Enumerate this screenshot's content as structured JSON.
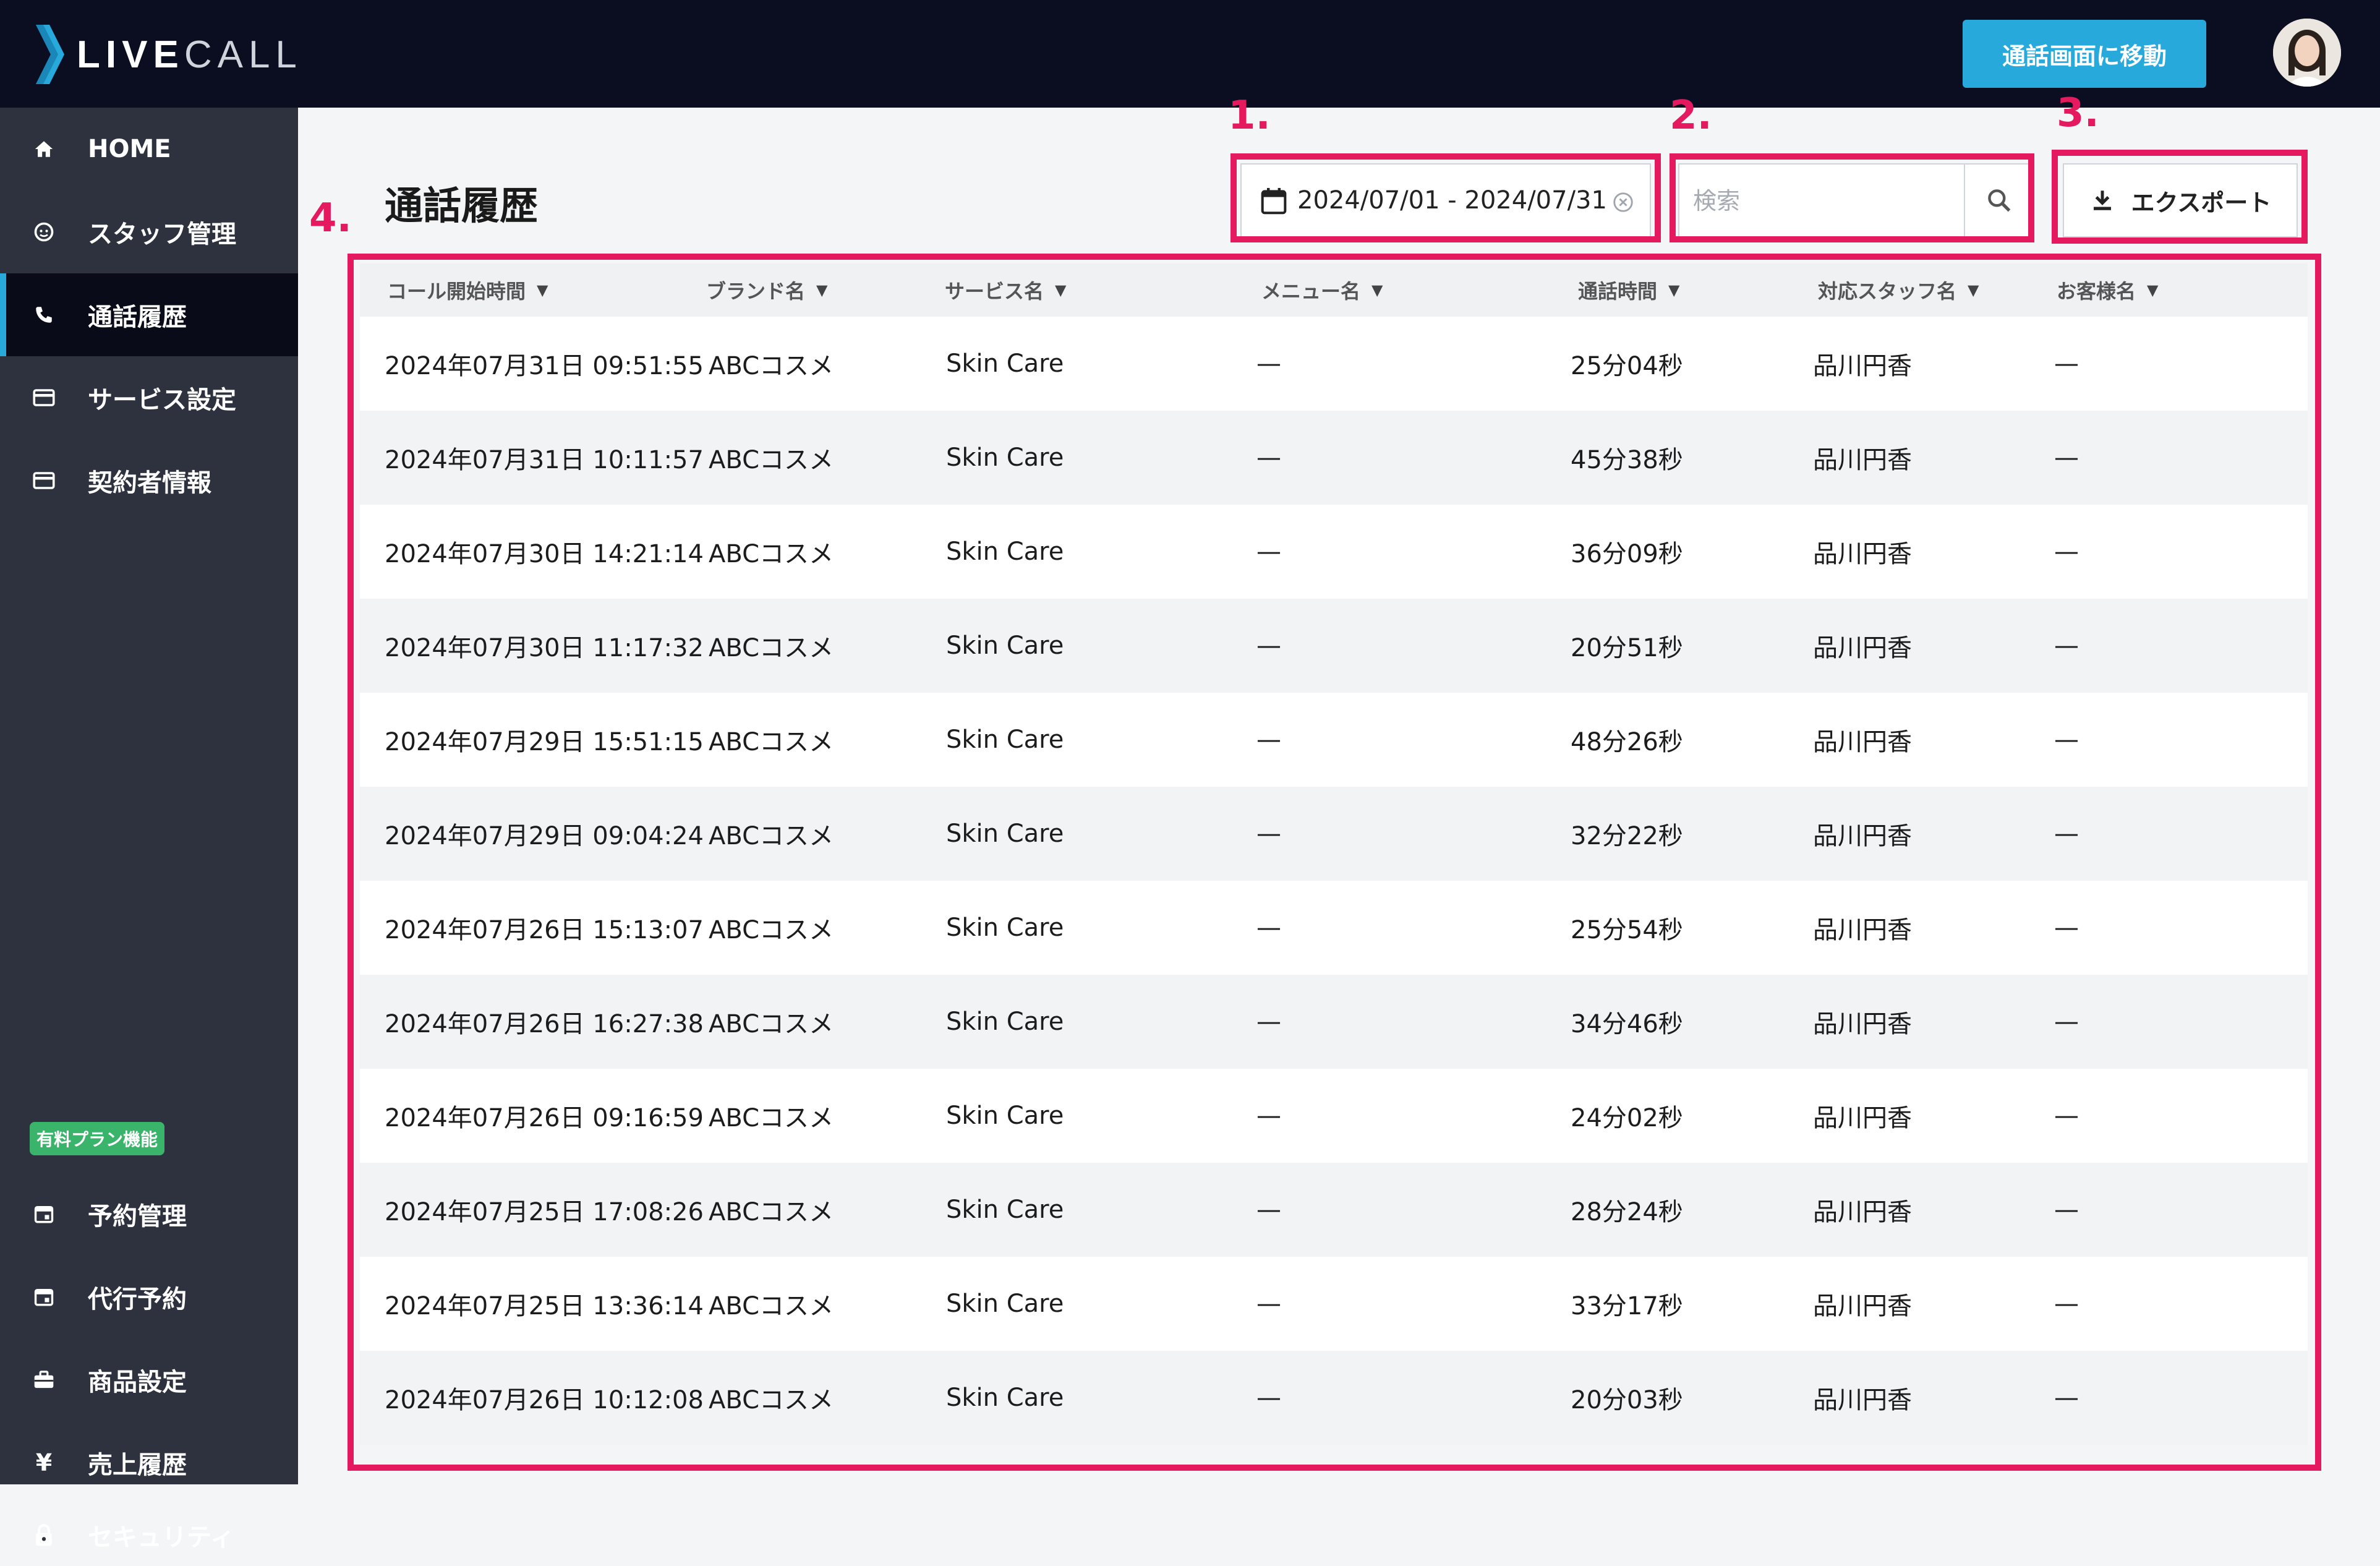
{
  "app": {
    "logo_bold": "LIVE",
    "logo_light": "CALL"
  },
  "header": {
    "call_screen_button": "通話画面に移動"
  },
  "sidebar": {
    "items": [
      {
        "label": "HOME",
        "icon": "home-icon"
      },
      {
        "label": "スタッフ管理",
        "icon": "staff-icon"
      },
      {
        "label": "通話履歴",
        "icon": "phone-icon",
        "active": true
      },
      {
        "label": "サービス設定",
        "icon": "card-icon"
      },
      {
        "label": "契約者情報",
        "icon": "card-icon"
      }
    ],
    "paid_badge": "有料プラン機能",
    "paid_items": [
      {
        "label": "予約管理",
        "icon": "calendar-icon"
      },
      {
        "label": "代行予約",
        "icon": "calendar-icon"
      },
      {
        "label": "商品設定",
        "icon": "briefcase-icon"
      },
      {
        "label": "売上履歴",
        "icon": "yen-icon"
      },
      {
        "label": "セキュリティ",
        "icon": "lock-icon"
      }
    ]
  },
  "main": {
    "title": "通話履歴",
    "date_range": "2024/07/01 - 2024/07/31",
    "search_placeholder": "検索",
    "export_label": "エクスポート",
    "annotations": [
      "1.",
      "2.",
      "3.",
      "4."
    ]
  },
  "table": {
    "headers": [
      "コール開始時間",
      "ブランド名",
      "サービス名",
      "メニュー名",
      "通話時間",
      "対応スタッフ名",
      "お客様名"
    ],
    "rows": [
      [
        "2024年07月31日 09:51:55",
        "ABCコスメ",
        "Skin Care",
        "—",
        "25分04秒",
        "品川円香",
        "—"
      ],
      [
        "2024年07月31日 10:11:57",
        "ABCコスメ",
        "Skin Care",
        "—",
        "45分38秒",
        "品川円香",
        "—"
      ],
      [
        "2024年07月30日 14:21:14",
        "ABCコスメ",
        "Skin Care",
        "—",
        "36分09秒",
        "品川円香",
        "—"
      ],
      [
        "2024年07月30日 11:17:32",
        "ABCコスメ",
        "Skin Care",
        "—",
        "20分51秒",
        "品川円香",
        "—"
      ],
      [
        "2024年07月29日 15:51:15",
        "ABCコスメ",
        "Skin Care",
        "—",
        "48分26秒",
        "品川円香",
        "—"
      ],
      [
        "2024年07月29日 09:04:24",
        "ABCコスメ",
        "Skin Care",
        "—",
        "32分22秒",
        "品川円香",
        "—"
      ],
      [
        "2024年07月26日 15:13:07",
        "ABCコスメ",
        "Skin Care",
        "—",
        "25分54秒",
        "品川円香",
        "—"
      ],
      [
        "2024年07月26日 16:27:38",
        "ABCコスメ",
        "Skin Care",
        "—",
        "34分46秒",
        "品川円香",
        "—"
      ],
      [
        "2024年07月26日 09:16:59",
        "ABCコスメ",
        "Skin Care",
        "—",
        "24分02秒",
        "品川円香",
        "—"
      ],
      [
        "2024年07月25日 17:08:26",
        "ABCコスメ",
        "Skin Care",
        "—",
        "28分24秒",
        "品川円香",
        "—"
      ],
      [
        "2024年07月25日 13:36:14",
        "ABCコスメ",
        "Skin Care",
        "—",
        "33分17秒",
        "品川円香",
        "—"
      ],
      [
        "2024年07月26日 10:12:08",
        "ABCコスメ",
        "Skin Care",
        "—",
        "20分03秒",
        "品川円香",
        "—"
      ]
    ]
  },
  "colors": {
    "accent": "#27a9dc",
    "annotation": "#e5195e",
    "sidebar": "#2e323f",
    "topbar": "#0b0d21",
    "badge": "#3bb46b"
  }
}
